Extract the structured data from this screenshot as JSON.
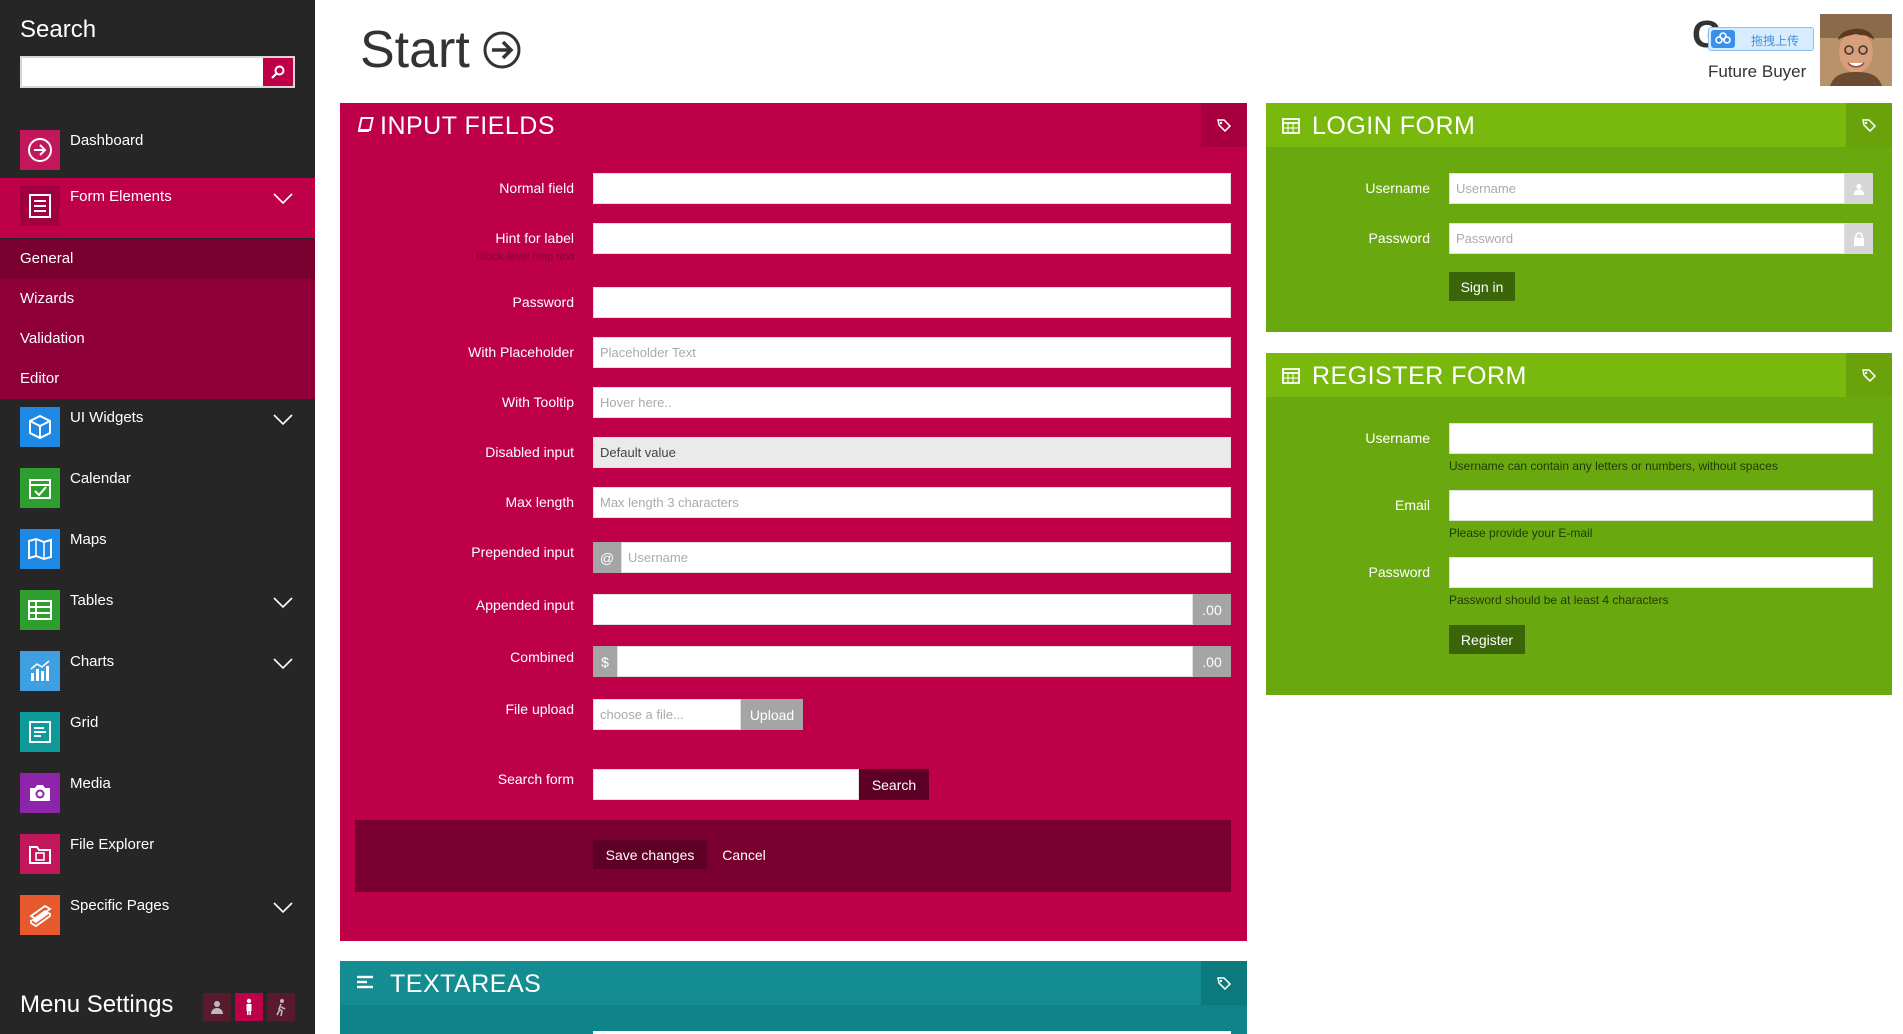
{
  "sidebar": {
    "search_title": "Search",
    "search_placeholder": "",
    "items": [
      {
        "label": "Dashboard",
        "icon": "arrow-circle-icon",
        "color": "#c2185b"
      },
      {
        "label": "Form Elements",
        "icon": "form-list-icon",
        "color": "#bd0048"
      },
      {
        "label": "UI Widgets",
        "icon": "cube-icon",
        "color": "#1e88e5"
      },
      {
        "label": "Calendar",
        "icon": "calendar-check-icon",
        "color": "#2e9e2e"
      },
      {
        "label": "Maps",
        "icon": "map-icon",
        "color": "#1e88e5"
      },
      {
        "label": "Tables",
        "icon": "table-icon",
        "color": "#2e9e2e"
      },
      {
        "label": "Charts",
        "icon": "bar-chart-icon",
        "color": "#3ea0e0"
      },
      {
        "label": "Grid",
        "icon": "grid-icon",
        "color": "#0f9a9a"
      },
      {
        "label": "Media",
        "icon": "camera-icon",
        "color": "#8e24aa"
      },
      {
        "label": "File Explorer",
        "icon": "folder-icon",
        "color": "#c2185b"
      },
      {
        "label": "Specific Pages",
        "icon": "book-icon",
        "color": "#e65a2e"
      }
    ],
    "sub_items": [
      "General",
      "Wizards",
      "Validation",
      "Editor"
    ],
    "menu_settings": "Menu Settings"
  },
  "header": {
    "title": "Start",
    "user_letter": "G",
    "user_name": "Future Buyer",
    "badge_text": "拖拽上传"
  },
  "input_fields": {
    "title": "INPUT FIELDS",
    "normal_label": "Normal field",
    "hint_label": "Hint for label",
    "hint_help": "Block-level help text",
    "password_label": "Password",
    "placeholder_label": "With Placeholder",
    "placeholder_text": "Placeholder Text",
    "tooltip_label": "With Tooltip",
    "tooltip_placeholder": "Hover here..",
    "disabled_label": "Disabled input",
    "disabled_value": "Default value",
    "maxlength_label": "Max length",
    "maxlength_placeholder": "Max length 3 characters",
    "prepended_label": "Prepended input",
    "prepended_addon": "@",
    "prepended_placeholder": "Username",
    "appended_label": "Appended input",
    "appended_addon": ".00",
    "combined_label": "Combined",
    "combined_prefix": "$",
    "combined_suffix": ".00",
    "file_label": "File upload",
    "file_placeholder": "choose a file...",
    "upload_btn": "Upload",
    "search_label": "Search form",
    "search_btn": "Search",
    "save_btn": "Save changes",
    "cancel_btn": "Cancel"
  },
  "login_form": {
    "title": "LOGIN FORM",
    "username_label": "Username",
    "username_placeholder": "Username",
    "password_label": "Password",
    "password_placeholder": "Password",
    "signin_btn": "Sign in"
  },
  "register_form": {
    "title": "REGISTER FORM",
    "username_label": "Username",
    "username_help": "Username can contain any letters or numbers, without spaces",
    "email_label": "Email",
    "email_help": "Please provide your E-mail",
    "password_label": "Password",
    "password_help": "Password should be at least 4 characters",
    "register_btn": "Register"
  },
  "textareas": {
    "title": "TEXTAREAS"
  }
}
